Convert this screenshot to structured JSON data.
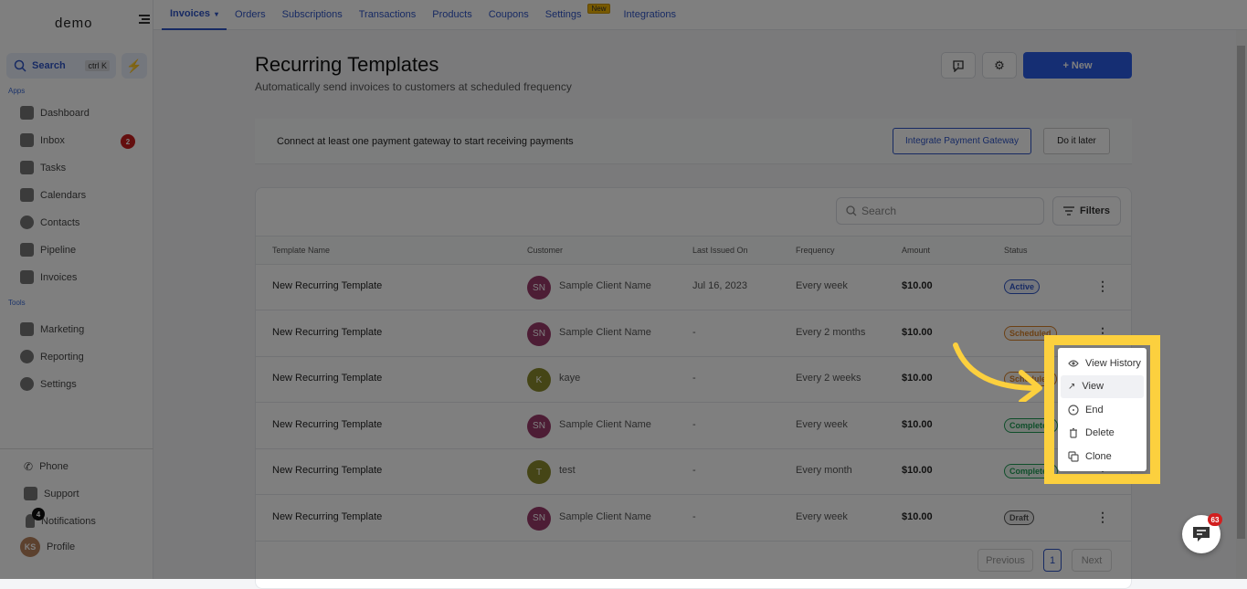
{
  "sidebar": {
    "logo": "demo",
    "search_label": "Search",
    "search_shortcut": "ctrl K",
    "apps_label": "Apps",
    "tools_label": "Tools",
    "apps": [
      {
        "label": "Dashboard",
        "icon": "dashboard-icon"
      },
      {
        "label": "Inbox",
        "icon": "inbox-icon",
        "badge": "2"
      },
      {
        "label": "Tasks",
        "icon": "tasks-icon"
      },
      {
        "label": "Calendars",
        "icon": "calendar-icon"
      },
      {
        "label": "Contacts",
        "icon": "contacts-icon"
      },
      {
        "label": "Pipeline",
        "icon": "pipeline-icon"
      },
      {
        "label": "Invoices",
        "icon": "invoices-icon"
      }
    ],
    "tools": [
      {
        "label": "Marketing",
        "icon": "megaphone-icon"
      },
      {
        "label": "Reporting",
        "icon": "pie-chart-icon"
      },
      {
        "label": "Settings",
        "icon": "gear-icon"
      }
    ],
    "bottom": {
      "phone": "Phone",
      "support": "Support",
      "notifications": "Notifications",
      "notifications_badge": "4",
      "profile": "Profile",
      "profile_initials": "KS"
    }
  },
  "topnav": {
    "tabs": [
      "Invoices",
      "Orders",
      "Subscriptions",
      "Transactions",
      "Products",
      "Coupons",
      "Settings",
      "Integrations"
    ],
    "active": "Invoices",
    "new_tag": "New"
  },
  "page": {
    "title": "Recurring Templates",
    "subtitle": "Automatically send invoices to customers at scheduled frequency",
    "new_button": "+ New"
  },
  "banner": {
    "text": "Connect at least one payment gateway to start receiving payments",
    "integrate_button": "Integrate Payment Gateway",
    "later_button": "Do it later"
  },
  "table": {
    "search_placeholder": "Search",
    "filters_label": "Filters",
    "columns": [
      "Template Name",
      "Customer",
      "Last Issued On",
      "Frequency",
      "Amount",
      "Status"
    ],
    "rows": [
      {
        "name": "New Recurring Template",
        "initials": "SN",
        "customer": "Sample Client Name",
        "avatar_color": "#9b3a6b",
        "last_issued": "Jul 16, 2023",
        "frequency": "Every week",
        "amount": "$10.00",
        "status": "Active"
      },
      {
        "name": "New Recurring Template",
        "initials": "SN",
        "customer": "Sample Client Name",
        "avatar_color": "#9b3a6b",
        "last_issued": "-",
        "frequency": "Every 2 months",
        "amount": "$10.00",
        "status": "Scheduled"
      },
      {
        "name": "New Recurring Template",
        "initials": "K",
        "customer": "kaye",
        "avatar_color": "#8a8a2c",
        "last_issued": "-",
        "frequency": "Every 2 weeks",
        "amount": "$10.00",
        "status": "Scheduled"
      },
      {
        "name": "New Recurring Template",
        "initials": "SN",
        "customer": "Sample Client Name",
        "avatar_color": "#9b3a6b",
        "last_issued": "-",
        "frequency": "Every week",
        "amount": "$10.00",
        "status": "Completed"
      },
      {
        "name": "New Recurring Template",
        "initials": "T",
        "customer": "test",
        "avatar_color": "#8a8a2c",
        "last_issued": "-",
        "frequency": "Every month",
        "amount": "$10.00",
        "status": "Completed"
      },
      {
        "name": "New Recurring Template",
        "initials": "SN",
        "customer": "Sample Client Name",
        "avatar_color": "#9b3a6b",
        "last_issued": "-",
        "frequency": "Every week",
        "amount": "$10.00",
        "status": "Draft"
      }
    ],
    "pagination": {
      "previous": "Previous",
      "current": "1",
      "next": "Next"
    }
  },
  "context_menu": {
    "items": [
      {
        "label": "View History",
        "icon": "eye-icon"
      },
      {
        "label": "View",
        "icon": "arrow-up-right-icon"
      },
      {
        "label": "End",
        "icon": "stop-circle-icon"
      },
      {
        "label": "Delete",
        "icon": "trash-icon"
      },
      {
        "label": "Clone",
        "icon": "clone-icon"
      }
    ]
  },
  "chat_widget": {
    "badge": "63"
  },
  "status_colors": {
    "Active": "#2f55c7",
    "Scheduled": "#d9822b",
    "Completed": "#1f9d55",
    "Draft": "#555555"
  },
  "accent": "#2a5ce6",
  "highlight": "#fcd03e"
}
